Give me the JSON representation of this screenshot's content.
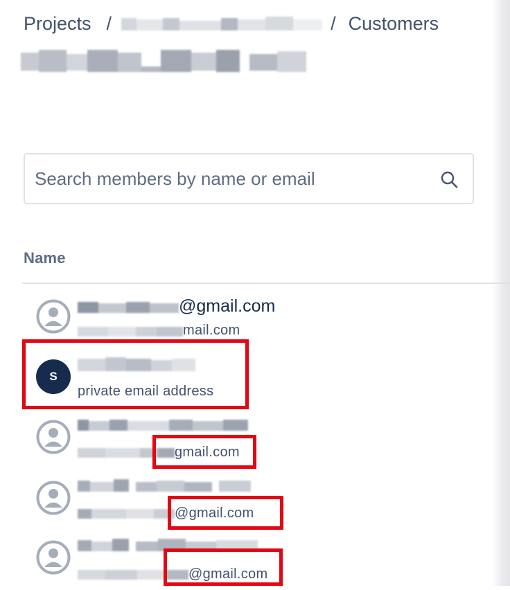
{
  "breadcrumb": {
    "root": "Projects",
    "separator": "/",
    "current": "Customers"
  },
  "search": {
    "placeholder": "Search members by name or email",
    "icon": "search-icon"
  },
  "table": {
    "column_name": "Name"
  },
  "members": [
    {
      "primary_visible": "@gmail.com",
      "secondary_visible": "mail.com",
      "avatar": "person-icon"
    },
    {
      "avatar_initial": "S",
      "secondary_visible": "private email address"
    },
    {
      "secondary_visible": "gmail.com",
      "avatar": "person-icon"
    },
    {
      "secondary_visible": "@gmail.com",
      "avatar": "person-icon"
    },
    {
      "secondary_visible": "@gmail.com",
      "avatar": "person-icon"
    }
  ],
  "colors": {
    "highlight": "#e30613",
    "avatar_initial_bg": "#172b4d",
    "placeholder_avatar": "#a5adba"
  }
}
